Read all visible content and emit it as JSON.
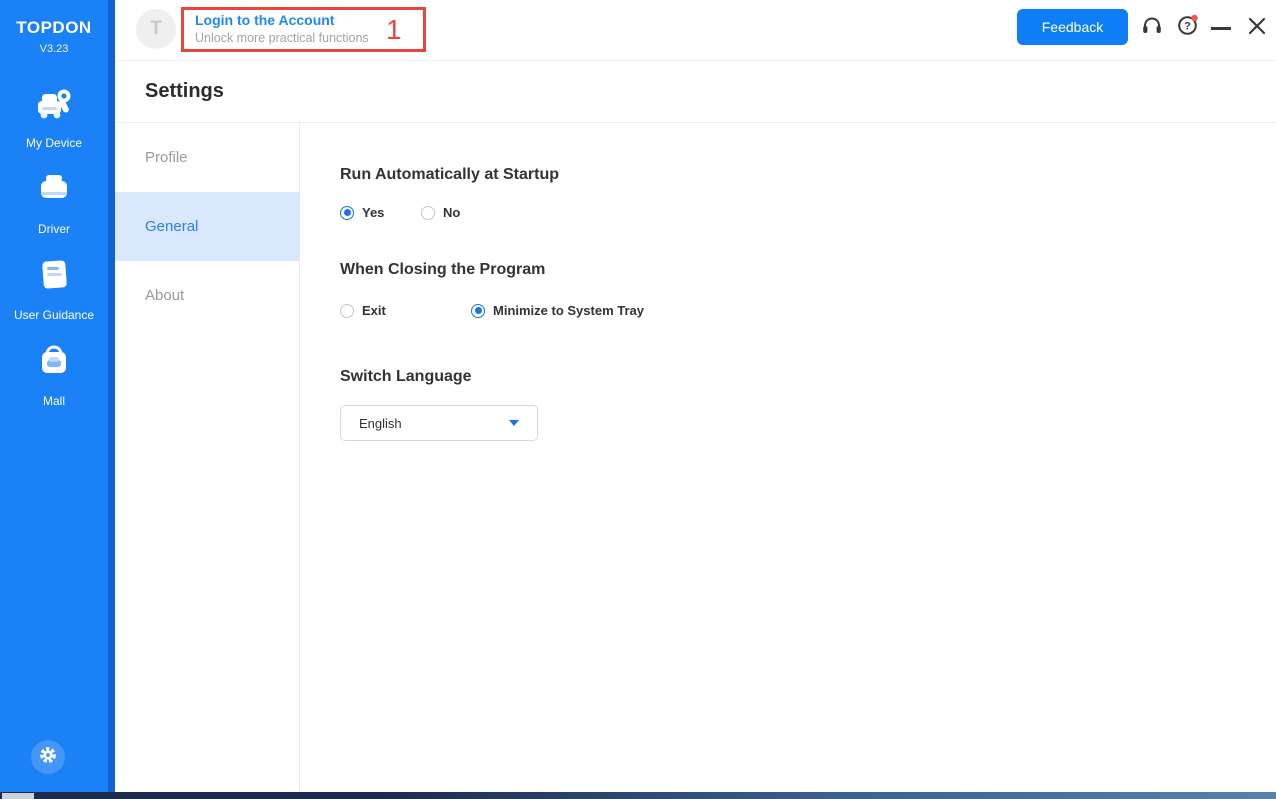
{
  "app": {
    "name": "TOPDON",
    "version": "V3.23"
  },
  "sidebar": {
    "items": [
      {
        "label": "My Device"
      },
      {
        "label": "Driver"
      },
      {
        "label": "User Guidance"
      },
      {
        "label": "Mall"
      }
    ]
  },
  "header": {
    "avatar_letter": "T",
    "login_title": "Login to the Account",
    "login_subtitle": "Unlock more practical functions",
    "annotation_number": "1",
    "feedback_label": "Feedback"
  },
  "settings": {
    "title": "Settings",
    "nav": [
      {
        "label": "Profile",
        "selected": false
      },
      {
        "label": "General",
        "selected": true
      },
      {
        "label": "About",
        "selected": false
      }
    ],
    "sections": {
      "startup": {
        "heading": "Run Automatically at Startup",
        "options": [
          {
            "label": "Yes",
            "selected": true
          },
          {
            "label": "No",
            "selected": false
          }
        ]
      },
      "closing": {
        "heading": "When Closing the Program",
        "options": [
          {
            "label": "Exit",
            "selected": false
          },
          {
            "label": "Minimize to System Tray",
            "selected": true
          }
        ]
      },
      "language": {
        "heading": "Switch Language",
        "value": "English"
      }
    }
  },
  "colors": {
    "sidebar_blue": "#1b81f7",
    "sidebar_edge_blue": "#1263cf",
    "accent_blue": "#1673e8",
    "link_blue": "#1e88f5",
    "selected_nav_bg": "#d9e8fc",
    "annotation_red": "#e8453c",
    "feedback_button_blue": "#0e7ef7"
  }
}
